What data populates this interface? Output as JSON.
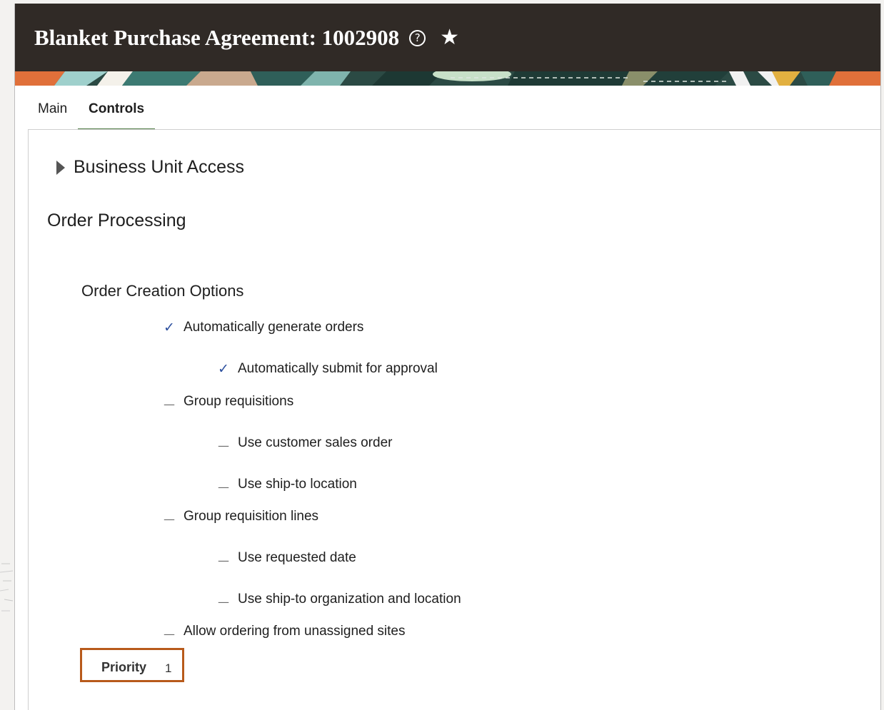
{
  "header": {
    "title": "Blanket Purchase Agreement: 1002908",
    "help_icon": "?",
    "favorite_icon": "★"
  },
  "colors": {
    "header_bg": "#302a26",
    "tab_underline": "#4f7d46",
    "check": "#2c4f9e",
    "highlight_border": "#b85a1b"
  },
  "tabs": [
    {
      "label": "Main",
      "active": false
    },
    {
      "label": "Controls",
      "active": true
    }
  ],
  "sections": {
    "business_unit_access": "Business Unit Access",
    "order_processing": "Order Processing",
    "order_creation_options": "Order Creation Options"
  },
  "options": [
    {
      "label": "Automatically generate orders",
      "checked": true,
      "mark": "✓"
    },
    {
      "label": "Automatically submit for approval",
      "checked": true,
      "mark": "✓"
    },
    {
      "label": "Group requisitions",
      "checked": false,
      "mark": "—"
    },
    {
      "label": "Use customer sales order",
      "checked": false,
      "mark": "—"
    },
    {
      "label": "Use ship-to location",
      "checked": false,
      "mark": "—"
    },
    {
      "label": "Group requisition lines",
      "checked": false,
      "mark": "—"
    },
    {
      "label": "Use requested date",
      "checked": false,
      "mark": "—"
    },
    {
      "label": "Use ship-to organization and location",
      "checked": false,
      "mark": "—"
    },
    {
      "label": "Allow ordering from unassigned sites",
      "checked": false,
      "mark": "—"
    }
  ],
  "priority": {
    "label": "Priority",
    "value": "1"
  }
}
